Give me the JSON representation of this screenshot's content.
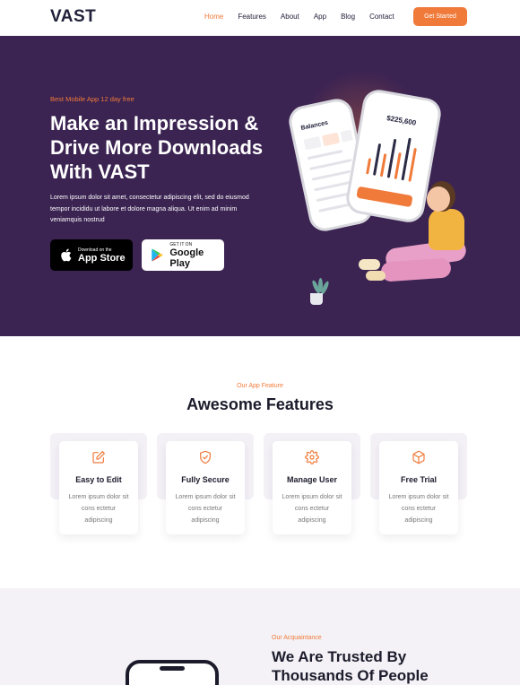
{
  "nav": {
    "logo": "VAST",
    "links": [
      "Home",
      "Features",
      "About",
      "App",
      "Blog",
      "Contact"
    ],
    "cta": "Get Started"
  },
  "hero": {
    "eyebrow": "Best Mobile App 12 day free",
    "title": "Make an Impression & Drive More Downloads With VAST",
    "desc": "Lorem ipsum dolor sit amet, consectetur adipiscing elit, sed do eiusmod tempor incididu ut labore et dolore magna aliqua. Ut enim ad minim veniamquis nostrud",
    "apple": {
      "small": "Download on the",
      "big": "App Store"
    },
    "google": {
      "small": "GET IT ON",
      "big": "Google Play"
    },
    "phone1": {
      "heading": "Balances"
    },
    "phone2": {
      "amount": "$225,600"
    }
  },
  "features": {
    "eyebrow": "Our App Feature",
    "title": "Awesome Features",
    "cards": [
      {
        "title": "Easy to Edit",
        "desc": "Lorem ipsum dolor sit cons ectetur adipiscing",
        "icon": "edit-icon"
      },
      {
        "title": "Fully Secure",
        "desc": "Lorem ipsum dolor sit cons ectetur adipiscing",
        "icon": "shield-icon"
      },
      {
        "title": "Manage User",
        "desc": "Lorem ipsum dolor sit cons ectetur adipiscing",
        "icon": "gear-icon"
      },
      {
        "title": "Free Trial",
        "desc": "Lorem ipsum dolor sit cons ectetur adipiscing",
        "icon": "box-icon"
      }
    ]
  },
  "trusted": {
    "eyebrow": "Our Acquaintance",
    "title": "We Are Trusted By Thousands Of People"
  },
  "colors": {
    "accent": "#f07a3a",
    "hero_bg": "#3b2352"
  }
}
